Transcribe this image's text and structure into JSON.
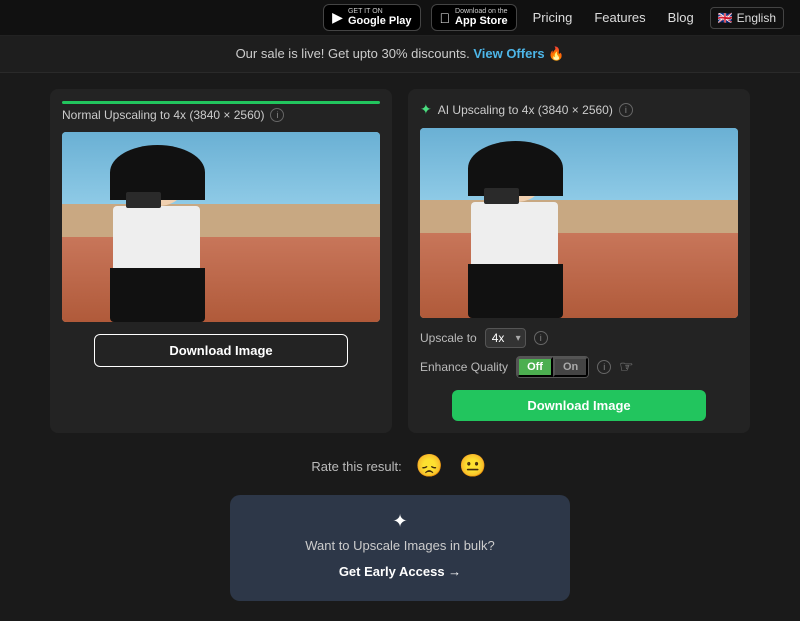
{
  "navbar": {
    "google_play_top": "GET IT ON",
    "google_play_bottom": "Google Play",
    "app_store_top": "Download on the",
    "app_store_bottom": "App Store",
    "pricing": "Pricing",
    "features": "Features",
    "blog": "Blog",
    "language": "English"
  },
  "promo_banner": {
    "text": "Our sale is live! Get upto 30% discounts.",
    "link_text": "View Offers",
    "emoji": "🔥"
  },
  "left_panel": {
    "title": "Normal Upscaling to 4x (3840 × 2560)",
    "download_label": "Download Image"
  },
  "right_panel": {
    "title": "AI Upscaling to 4x (3840 × 2560)",
    "upscale_label": "Upscale to",
    "upscale_value": "4x",
    "enhance_label": "Enhance Quality",
    "toggle_off": "Off",
    "toggle_on": "On",
    "download_label": "Download Image"
  },
  "rating": {
    "label": "Rate this result:",
    "emoji_bad": "😞",
    "emoji_neutral": "😐"
  },
  "promo_box": {
    "icon": "✦",
    "text": "Want to Upscale Images in bulk?",
    "link": "Get Early Access →"
  }
}
